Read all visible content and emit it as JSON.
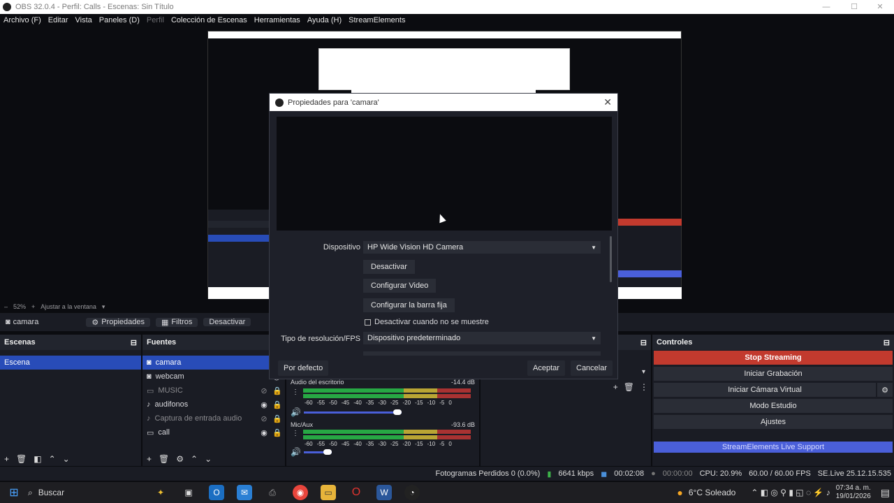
{
  "window": {
    "title": "OBS 32.0.4 - Perfil: Calls - Escenas: Sin Título"
  },
  "menu": [
    "Archivo (F)",
    "Editar",
    "Vista",
    "Paneles (D)",
    "Perfil",
    "Colección de Escenas",
    "Herramientas",
    "Ayuda (H)",
    "StreamElements"
  ],
  "zoom": {
    "percent": "52%",
    "fit": "Ajustar a la ventana"
  },
  "sourcebar": {
    "name": "camara",
    "properties": "Propiedades",
    "filters": "Filtros",
    "disable": "Desactivar"
  },
  "scenes": {
    "title": "Escenas",
    "items": [
      "Escena"
    ]
  },
  "sources": {
    "title": "Fuentes",
    "items": [
      "camara",
      "webcam",
      "MUSIC",
      "audifonos",
      "Captura de entrada audio",
      "call"
    ]
  },
  "mixer": {
    "track1": {
      "name": "Audio del escritorio",
      "level": "-14.4 dB"
    },
    "track2": {
      "name": "Mic/Aux",
      "level": "-93.6 dB"
    },
    "scale": [
      "-60",
      "-55",
      "-50",
      "-45",
      "-40",
      "-35",
      "-30",
      "-25",
      "-20",
      "-15",
      "-10",
      "-5",
      "0"
    ]
  },
  "controls": {
    "title": "Controles",
    "stop_streaming": "Stop Streaming",
    "start_recording": "Iniciar Grabación",
    "virtual_cam": "Iniciar Cámara Virtual",
    "studio_mode": "Modo Estudio",
    "settings": "Ajustes",
    "support": "StreamElements Live Support"
  },
  "status": {
    "dropped": "Fotogramas Perdidos 0 (0.0%)",
    "bitrate": "6641 kbps",
    "stream_time": "00:02:08",
    "rec_time": "00:00:00",
    "cpu": "CPU: 20.9%",
    "fps": "60.00 / 60.00 FPS",
    "version": "SE.Live 25.12.15.535"
  },
  "dialog": {
    "title": "Propiedades para 'camara'",
    "device_label": "Dispositivo",
    "device_value": "HP Wide Vision HD Camera",
    "btn_disable": "Desactivar",
    "btn_config_video": "Configurar Video",
    "btn_config_bar": "Configurar la barra fija",
    "checkbox": "Desactivar cuando no se muestre",
    "res_label": "Tipo de resolución/FPS",
    "res_value": "Dispositivo predeterminado",
    "defaults": "Por defecto",
    "accept": "Aceptar",
    "cancel": "Cancelar"
  },
  "taskbar": {
    "search": "Buscar",
    "weather": "6°C  Soleado",
    "time": "07:34 a. m.",
    "date": "19/01/2026"
  }
}
